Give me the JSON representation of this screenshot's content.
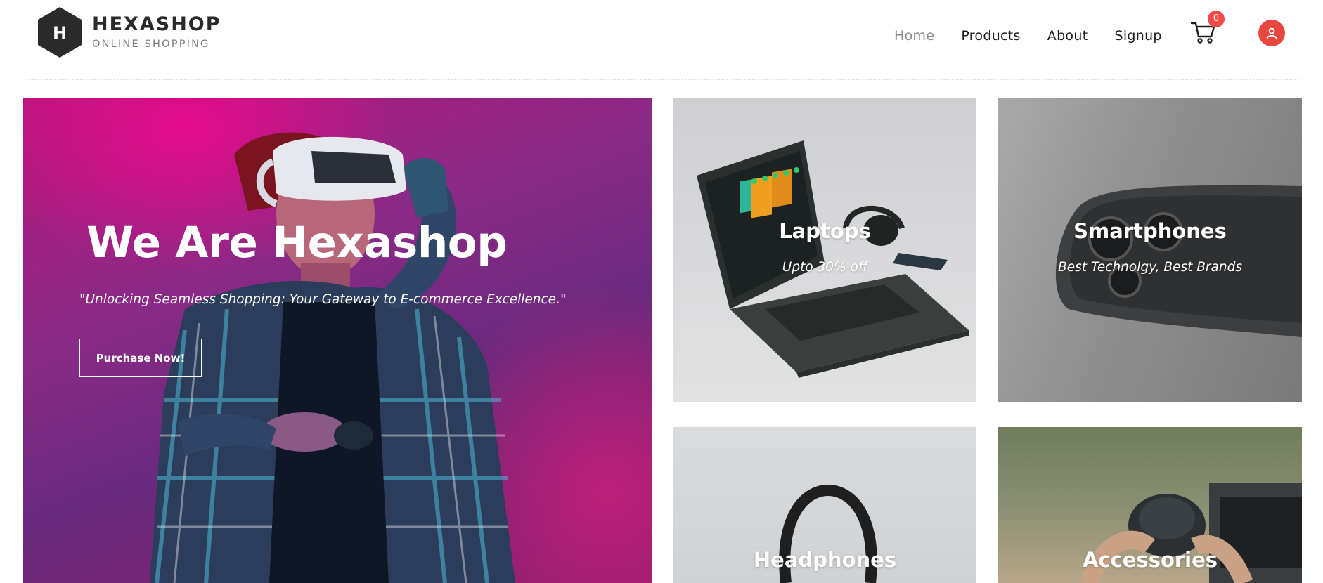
{
  "brand": {
    "initial": "H",
    "title": "HEXASHOP",
    "subtitle": "ONLINE SHOPPING"
  },
  "nav": {
    "home": "Home",
    "products": "Products",
    "about": "About",
    "signup": "Signup"
  },
  "cart": {
    "count": "0",
    "icon": "cart-icon"
  },
  "user": {
    "icon": "user-icon"
  },
  "hero": {
    "title": "We Are Hexashop",
    "quote": "\"Unlocking Seamless Shopping: Your Gateway to E-commerce Excellence.\"",
    "button": "Purchase Now!"
  },
  "categories": [
    {
      "title": "Laptops",
      "subtitle": "Upto 30% off"
    },
    {
      "title": "Smartphones",
      "subtitle": "Best Technolgy, Best Brands"
    },
    {
      "title": "Headphones",
      "subtitle": ""
    },
    {
      "title": "Accessories",
      "subtitle": ""
    }
  ],
  "colors": {
    "accent": "#f04a4a",
    "avatar": "#e8473f",
    "nav_active": "#8c8c8c",
    "text_dark": "#1e1e1e"
  }
}
